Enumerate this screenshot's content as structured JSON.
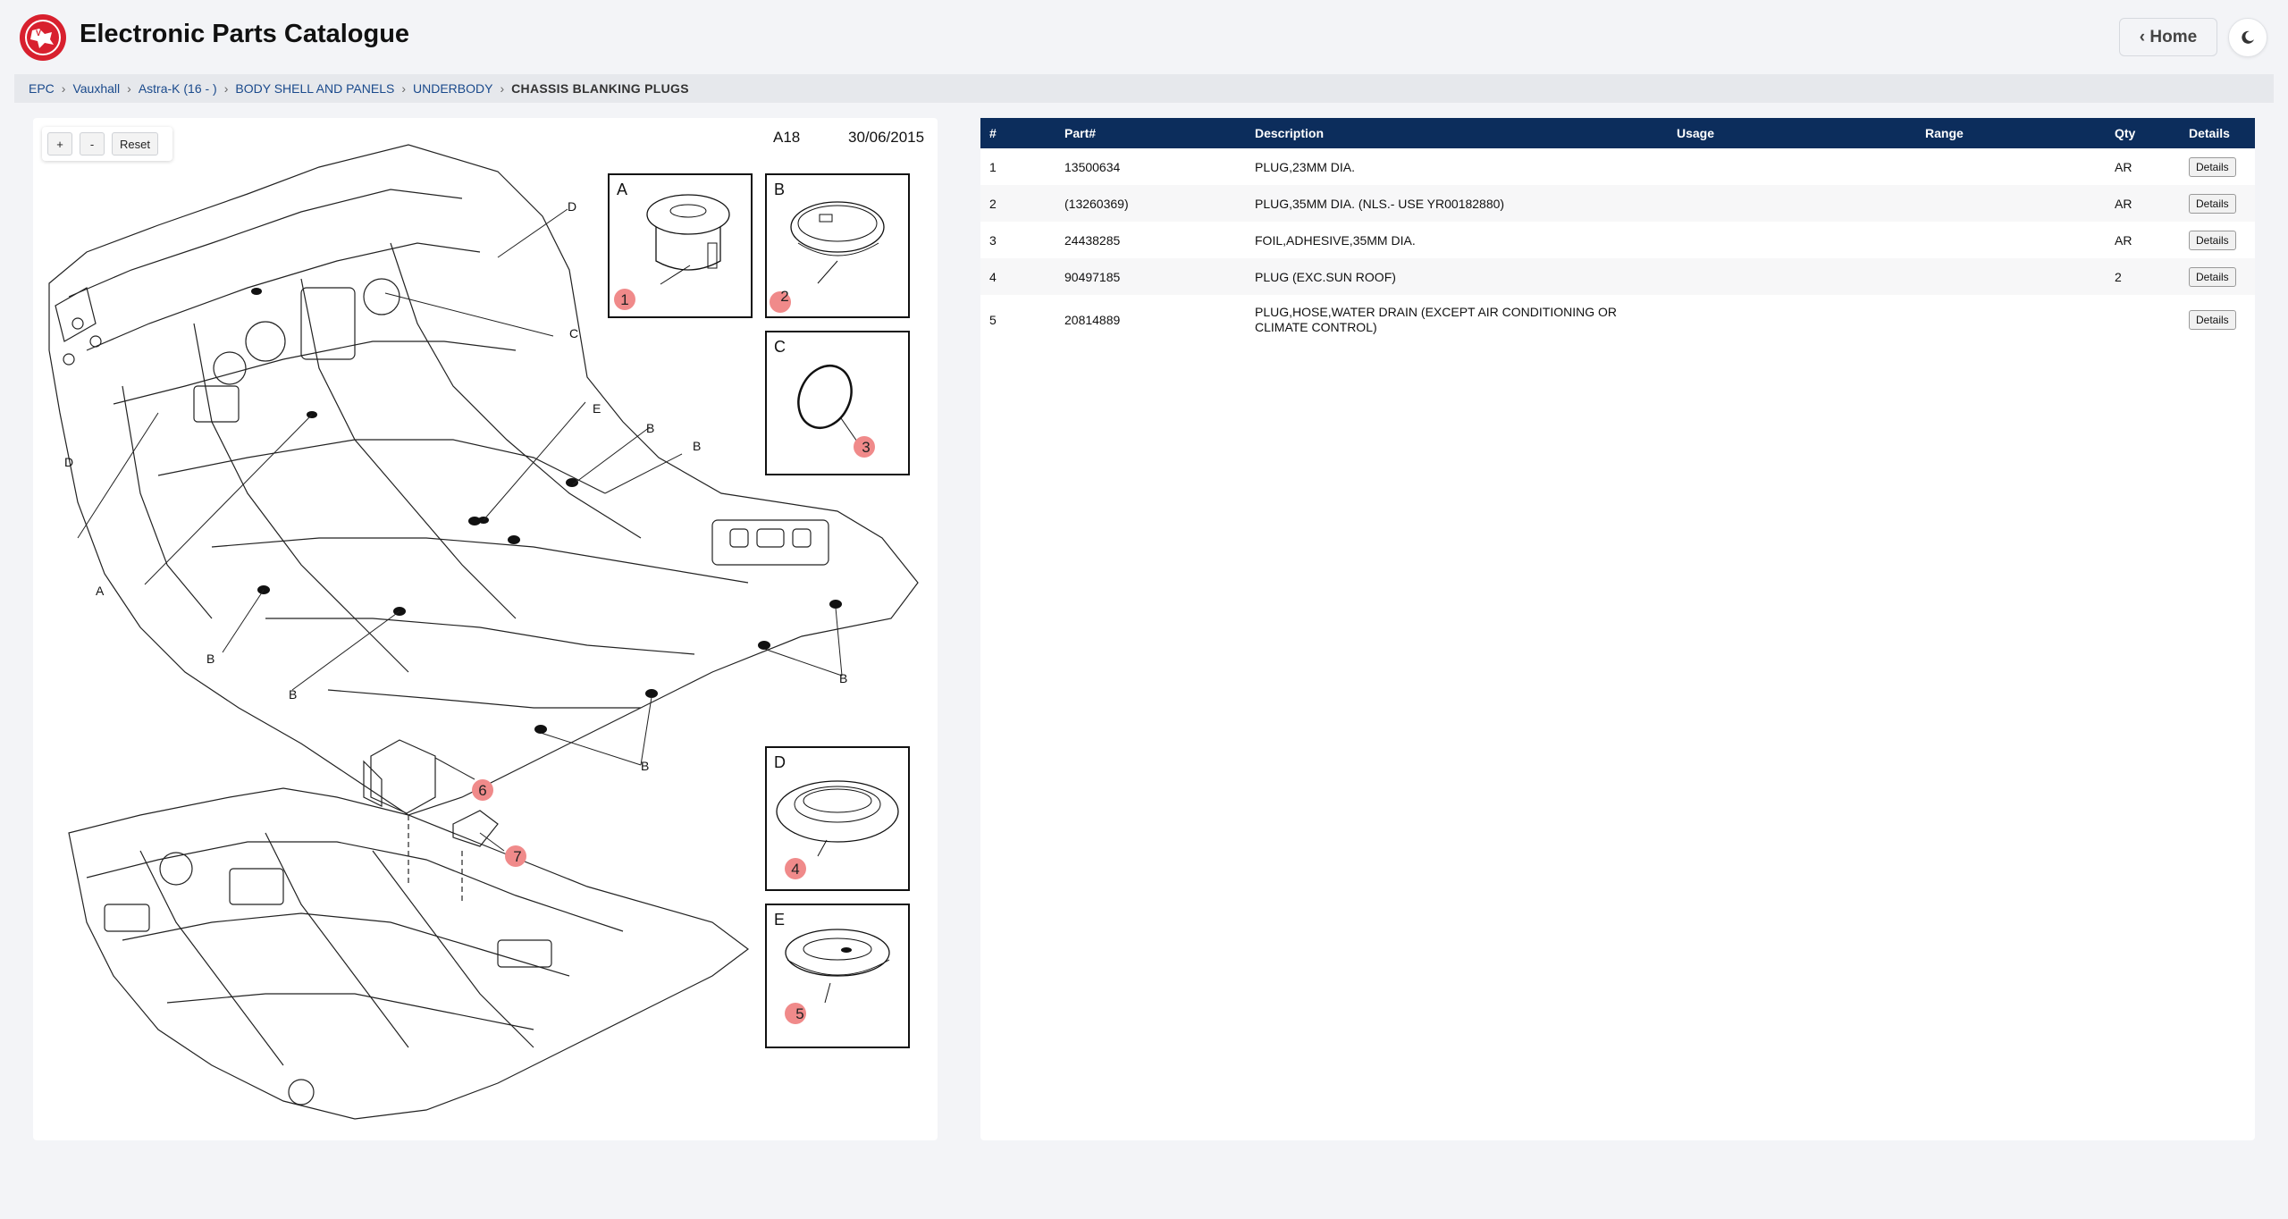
{
  "header": {
    "title": "Electronic Parts Catalogue",
    "home_label": "‹ Home",
    "logo_icon": "vauxhall-griffin-logo",
    "theme_icon": "moon-icon"
  },
  "breadcrumb": {
    "items": [
      "EPC",
      "Vauxhall",
      "Astra-K (16 - )",
      "BODY SHELL AND PANELS",
      "UNDERBODY"
    ],
    "current": "CHASSIS BLANKING PLUGS"
  },
  "diagram": {
    "zoom_in": "+",
    "zoom_out": "-",
    "reset": "Reset",
    "code": "A18",
    "date": "30/06/2015",
    "detail_letters": [
      "A",
      "B",
      "C",
      "D",
      "E"
    ],
    "callouts": [
      "1",
      "2",
      "3",
      "4",
      "5",
      "6",
      "7"
    ],
    "leader_labels": {
      "d1": "D",
      "c1": "C",
      "d2": "D",
      "e1": "E",
      "b1": "B",
      "b2": "B",
      "a1": "A",
      "b3": "B",
      "b4": "B",
      "b5": "B",
      "b6": "B"
    },
    "accent_color": "#f08a8a"
  },
  "table": {
    "columns": [
      "#",
      "Part#",
      "Description",
      "Usage",
      "Range",
      "Qty",
      "Details"
    ],
    "details_label": "Details",
    "rows": [
      {
        "num": "1",
        "part": "13500634",
        "desc": "PLUG,23MM DIA.",
        "usage": "",
        "range": "",
        "qty": "AR"
      },
      {
        "num": "2",
        "part": "(13260369)",
        "desc": "PLUG,35MM DIA. (NLS.- USE YR00182880)",
        "usage": "",
        "range": "",
        "qty": "AR"
      },
      {
        "num": "3",
        "part": "24438285",
        "desc": "FOIL,ADHESIVE,35MM DIA.",
        "usage": "",
        "range": "",
        "qty": "AR"
      },
      {
        "num": "4",
        "part": "90497185",
        "desc": "PLUG (EXC.SUN ROOF)",
        "usage": "",
        "range": "",
        "qty": "2"
      },
      {
        "num": "5",
        "part": "20814889",
        "desc": "PLUG,HOSE,WATER DRAIN (EXCEPT AIR CONDITIONING OR CLIMATE CONTROL)",
        "usage": "",
        "range": "",
        "qty": ""
      }
    ]
  },
  "colors": {
    "brand_red": "#d8202e",
    "table_header": "#0c2d5c",
    "link": "#1a4a8c"
  }
}
